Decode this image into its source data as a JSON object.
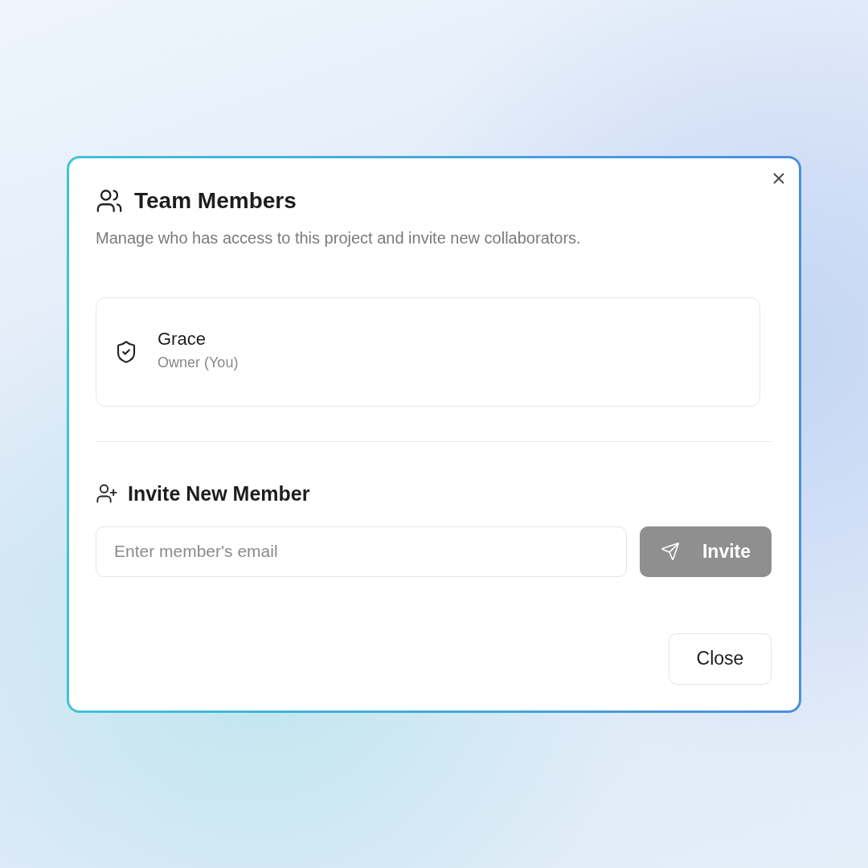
{
  "dialog": {
    "title": "Team Members",
    "description": "Manage who has access to this project and invite new collaborators."
  },
  "members": [
    {
      "name": "Grace",
      "role": "Owner (You)"
    }
  ],
  "invite": {
    "heading": "Invite New Member",
    "placeholder": "Enter member's email",
    "button": {
      "label": "Invite",
      "disabled": true
    }
  },
  "footer": {
    "close_label": "Close"
  }
}
